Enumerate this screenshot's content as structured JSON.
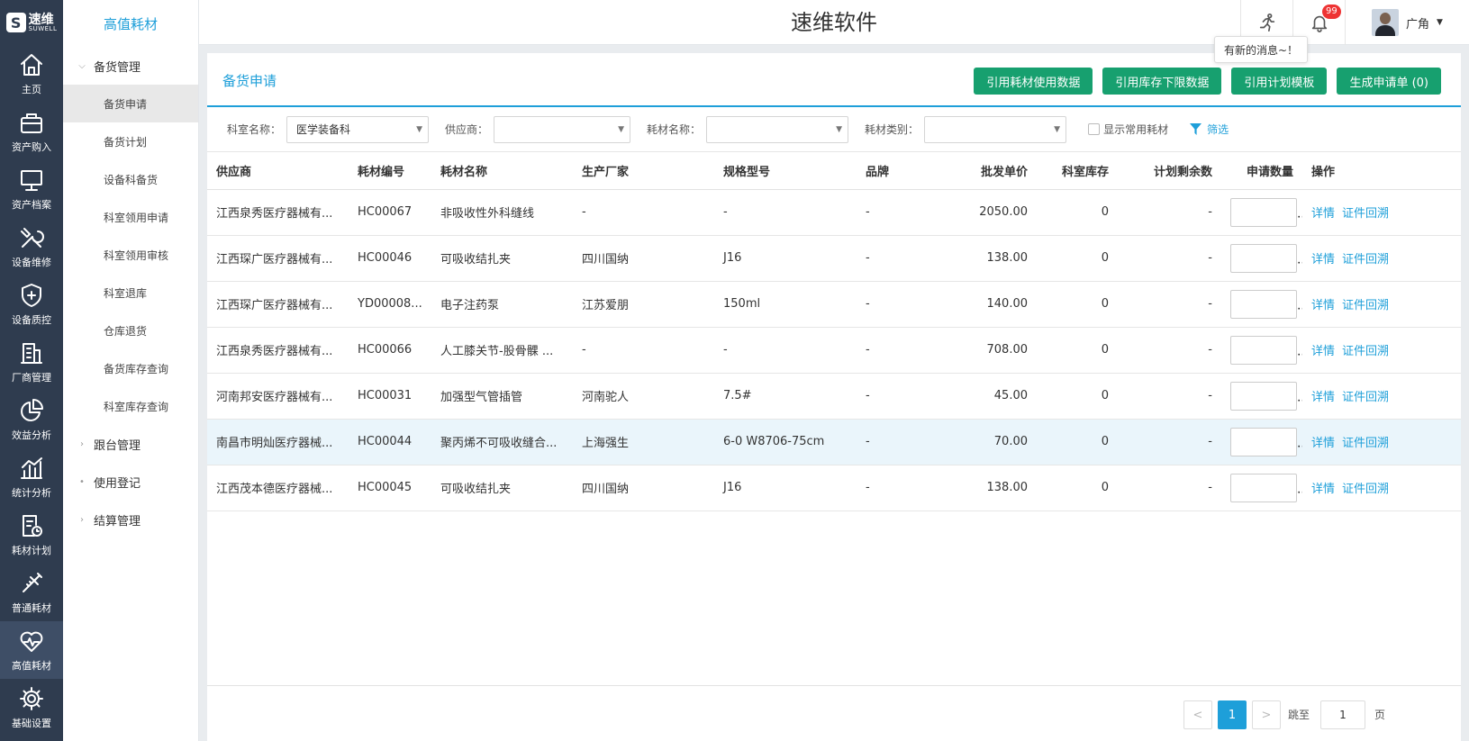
{
  "logo": {
    "mark": "S",
    "cn": "速维",
    "en": "SUWELL"
  },
  "rail": [
    {
      "label": "主页",
      "icon": "home-icon"
    },
    {
      "label": "资产购入",
      "icon": "cart-icon"
    },
    {
      "label": "资产档案",
      "icon": "monitor-icon"
    },
    {
      "label": "设备维修",
      "icon": "wrench-icon"
    },
    {
      "label": "设备质控",
      "icon": "shield-icon"
    },
    {
      "label": "厂商管理",
      "icon": "building-icon"
    },
    {
      "label": "效益分析",
      "icon": "pie-chart-icon"
    },
    {
      "label": "统计分析",
      "icon": "bar-chart-icon"
    },
    {
      "label": "耗材计划",
      "icon": "doc-clock-icon"
    },
    {
      "label": "普通耗材",
      "icon": "syringe-icon"
    },
    {
      "label": "高值耗材",
      "icon": "heart-pulse-icon"
    },
    {
      "label": "基础设置",
      "icon": "gear-icon"
    }
  ],
  "submenu": {
    "title": "高值耗材",
    "group_open": "备货管理",
    "leaves": [
      "备货申请",
      "备货计划",
      "设备科备货",
      "科室领用申请",
      "科室领用审核",
      "科室退库",
      "仓库退货",
      "备货库存查询",
      "科室库存查询"
    ],
    "groups_after": [
      "跟台管理",
      "使用登记",
      "结算管理"
    ]
  },
  "header": {
    "title": "速维软件",
    "badge": "99",
    "user": "广角",
    "tooltip": "有新的消息~！"
  },
  "panel": {
    "title": "备货申请",
    "buttons": [
      "引用耗材使用数据",
      "引用库存下限数据",
      "引用计划模板",
      "生成申请单 (0)"
    ]
  },
  "filters": {
    "dept_label": "科室名称：",
    "dept_value": "医学装备科",
    "supplier_label": "供应商：",
    "supplier_value": "",
    "material_label": "耗材名称：",
    "material_value": "",
    "type_label": "耗材类别：",
    "type_value": "",
    "common_label": "显示常用耗材",
    "filter_label": "筛选"
  },
  "table": {
    "headers": [
      "供应商",
      "耗材编号",
      "耗材名称",
      "生产厂家",
      "规格型号",
      "品牌",
      "批发单价",
      "科室库存",
      "计划剩余数",
      "申请数量",
      "操作"
    ],
    "rows": [
      [
        "江西泉秀医疗器械有...",
        "HC00067",
        "非吸收性外科缝线",
        "-",
        "-",
        "-",
        "2050.00",
        "0",
        "-"
      ],
      [
        "江西琛广医疗器械有...",
        "HC00046",
        "可吸收结扎夹",
        "四川国纳",
        "J16",
        "-",
        "138.00",
        "0",
        "-"
      ],
      [
        "江西琛广医疗器械有...",
        "YD00008...",
        "电子注药泵",
        "江苏爱朋",
        "150ml",
        "-",
        "140.00",
        "0",
        "-"
      ],
      [
        "江西泉秀医疗器械有...",
        "HC00066",
        "人工膝关节-股骨髁 ...",
        "-",
        "-",
        "-",
        "708.00",
        "0",
        "-"
      ],
      [
        "河南邦安医疗器械有...",
        "HC00031",
        "加强型气管插管",
        "河南驼人",
        "7.5#",
        "-",
        "45.00",
        "0",
        "-"
      ],
      [
        "南昌市明灿医疗器械...",
        "HC00044",
        "聚丙烯不可吸收缝合...",
        "上海强生",
        "6-0 W8706-75cm",
        "-",
        "70.00",
        "0",
        "-"
      ],
      [
        "江西茂本德医疗器械...",
        "HC00045",
        "可吸收结扎夹",
        "四川国纳",
        "J16",
        "-",
        "138.00",
        "0",
        "-"
      ]
    ],
    "op_detail": "详情",
    "op_trace": "证件回溯"
  },
  "pager": {
    "prev": "<",
    "current": "1",
    "next": ">",
    "goto": "跳至",
    "goto_value": "1",
    "page": "页"
  }
}
